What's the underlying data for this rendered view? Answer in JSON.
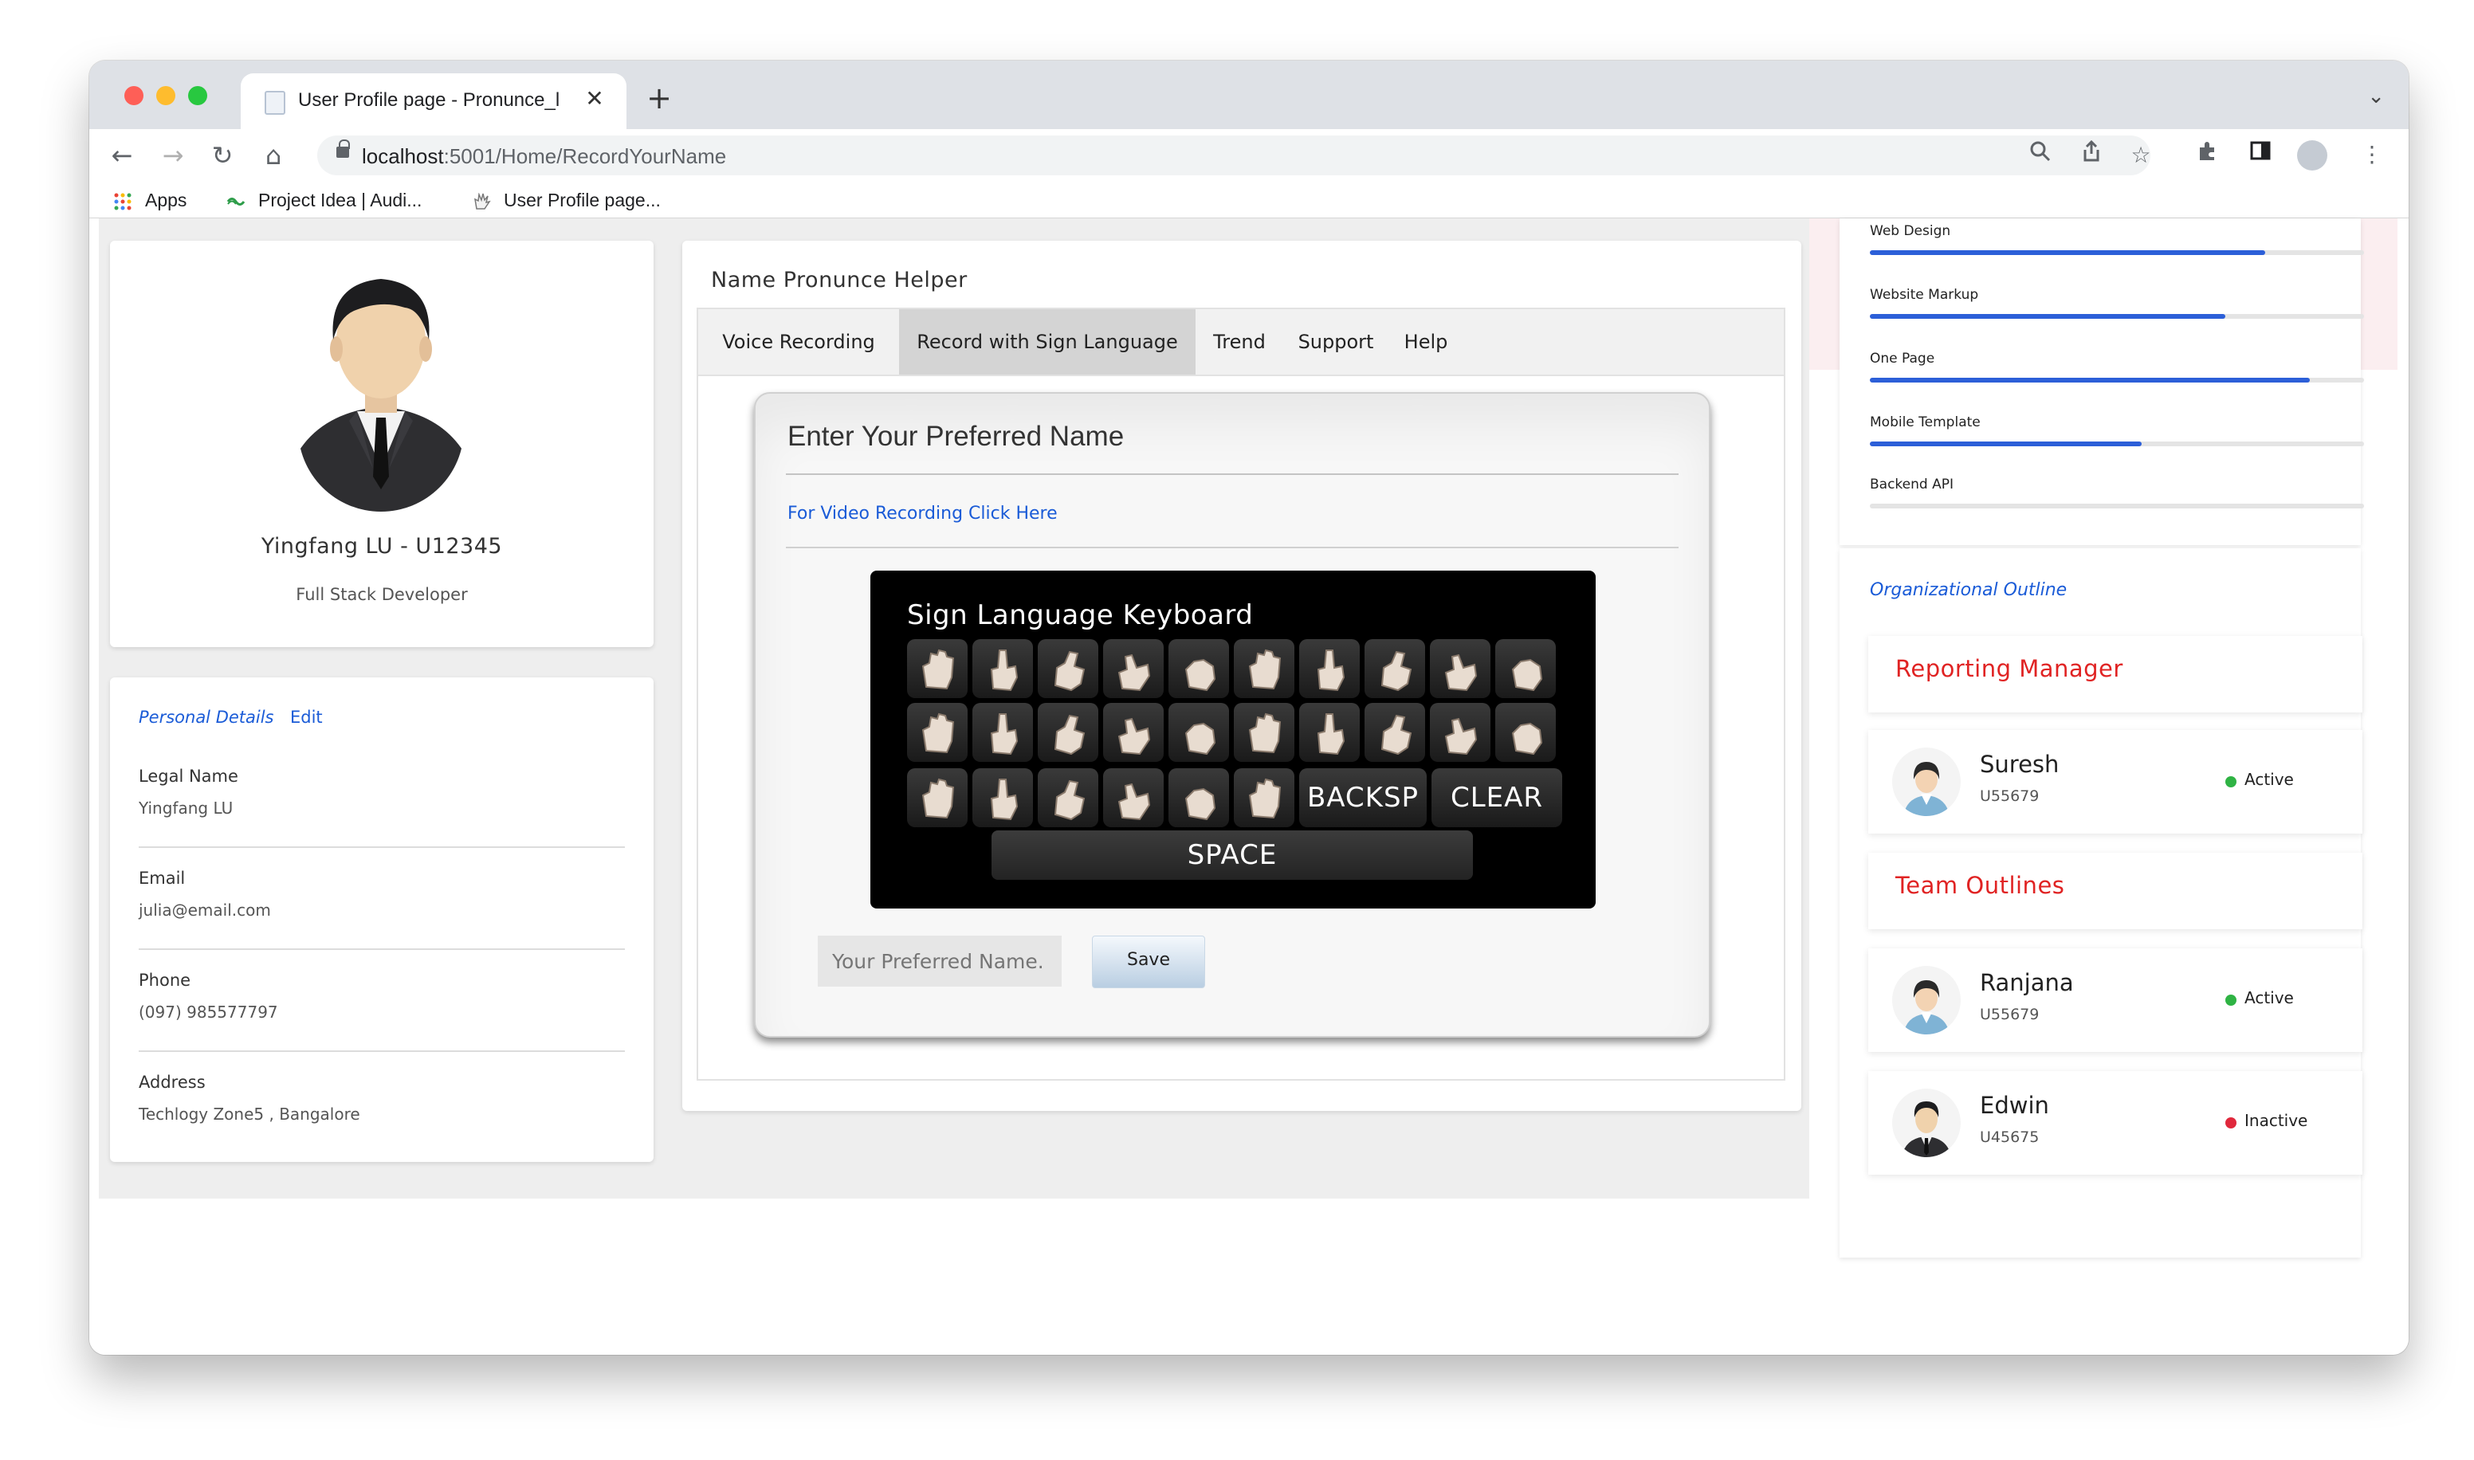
{
  "browser": {
    "tab_title": "User Profile page - Pronunce_l",
    "tab_close": "✕",
    "new_tab": "+",
    "url_host": "localhost",
    "url_path": ":5001/Home/RecordYourName",
    "bookmarks": [
      {
        "label": "Apps",
        "icon": "apps-grid-icon"
      },
      {
        "label": "Project Idea | Audi...",
        "icon": "bookmark-favicon-icon"
      },
      {
        "label": "User Profile page...",
        "icon": "sign-hand-icon"
      }
    ]
  },
  "profile": {
    "name": "Yingfang LU - U12345",
    "role": "Full Stack Developer"
  },
  "personal_details": {
    "title": "Personal Details",
    "edit": "Edit",
    "fields": [
      {
        "label": "Legal Name",
        "value": "Yingfang LU"
      },
      {
        "label": "Email",
        "value": "julia@email.com"
      },
      {
        "label": "Phone",
        "value": "(097) 985577797"
      },
      {
        "label": "Address",
        "value": "Techlogy Zone5 , Bangalore"
      }
    ]
  },
  "helper": {
    "title": "Name Pronunce Helper",
    "tabs": [
      "Voice Recording",
      "Record with Sign Language",
      "Trend",
      "Support",
      "Help"
    ],
    "active_tab": "Record with Sign Language",
    "form_heading": "Enter Your Preferred Name",
    "video_link": "For Video Recording Click Here",
    "keyboard_title": "Sign Language Keyboard",
    "backspace_label": "BACKSP",
    "clear_label": "CLEAR",
    "space_label": "SPACE",
    "name_placeholder": "Your Preferred Name.",
    "save_label": "Save"
  },
  "skills": [
    {
      "label": "Web Design",
      "level": 0.8
    },
    {
      "label": "Website Markup",
      "level": 0.72
    },
    {
      "label": "One Page",
      "level": 0.89
    },
    {
      "label": "Mobile Template",
      "level": 0.55
    },
    {
      "label": "Backend API",
      "level": 0.0
    }
  ],
  "org": {
    "title": "Organizational Outline",
    "reporting_manager_title": "Reporting Manager",
    "team_title": "Team Outlines",
    "manager": {
      "name": "Suresh",
      "id": "U55679",
      "status": "Active",
      "status_color": "#2fb344"
    },
    "team": [
      {
        "name": "Ranjana",
        "id": "U55679",
        "status": "Active",
        "status_color": "#2fb344"
      },
      {
        "name": "Edwin",
        "id": "U45675",
        "status": "Inactive",
        "status_color": "#e0283c"
      }
    ]
  },
  "colors": {
    "link_blue": "#1a5bd7",
    "heading_red": "#e02323",
    "skill_bar_blue": "#2c5fd8"
  }
}
